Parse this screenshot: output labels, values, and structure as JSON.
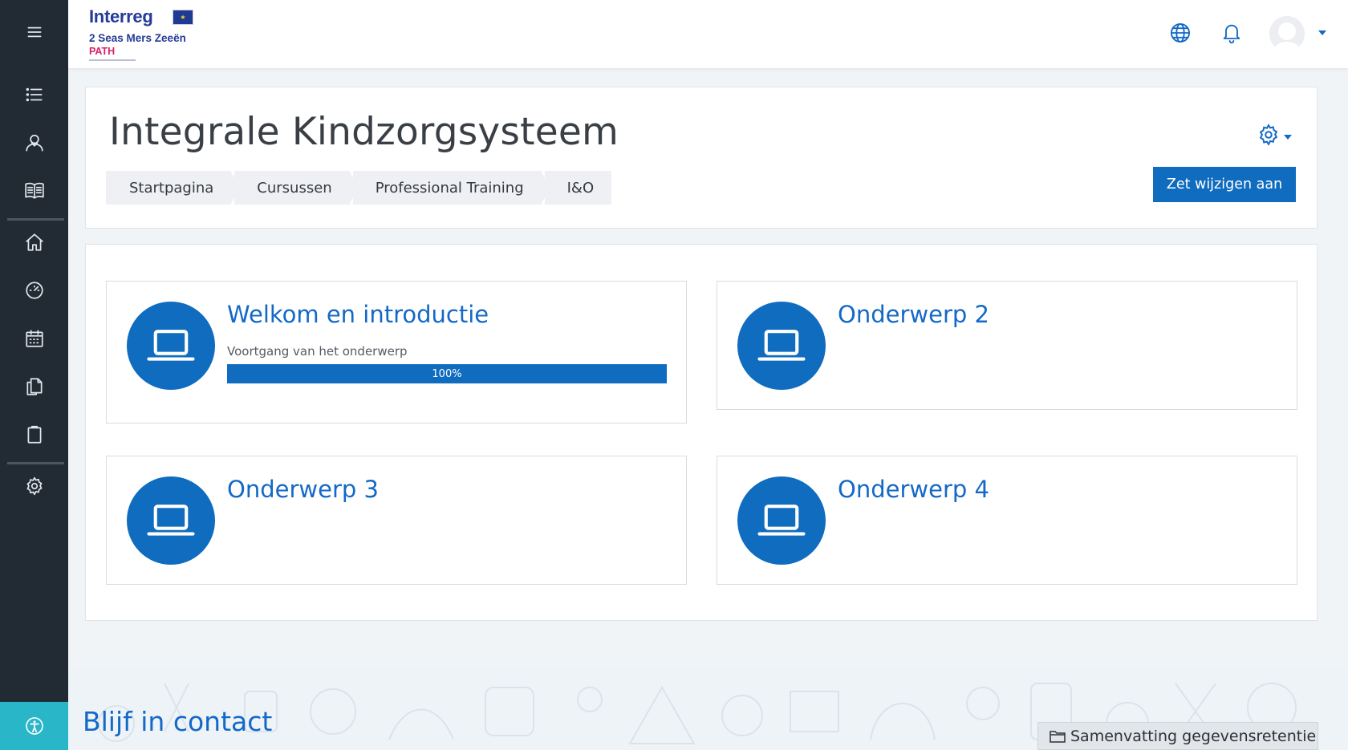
{
  "logo": {
    "line1": "Interreg",
    "line2": "2 Seas Mers Zeeën",
    "line3": "PATH"
  },
  "sidebar": {
    "items": [
      {
        "icon": "menu-icon"
      },
      {
        "icon": "list-icon"
      },
      {
        "icon": "participants-icon"
      },
      {
        "icon": "book-icon"
      },
      {
        "icon": "home-icon"
      },
      {
        "icon": "dashboard-icon"
      },
      {
        "icon": "calendar-icon"
      },
      {
        "icon": "files-icon"
      },
      {
        "icon": "clipboard-icon"
      },
      {
        "icon": "gear-icon"
      },
      {
        "icon": "accessibility-icon"
      }
    ]
  },
  "topbar": {
    "icons": [
      "globe-icon",
      "bell-icon",
      "avatar",
      "chevron-down-icon"
    ]
  },
  "header": {
    "title": "Integrale Kindzorgsysteem",
    "breadcrumb": [
      "Startpagina",
      "Cursussen",
      "Professional Training",
      "I&O"
    ],
    "edit_button": "Zet wijzigen aan"
  },
  "topics": [
    {
      "title": "Welkom en introductie",
      "progress_label": "Voortgang van het onderwerp",
      "progress_text": "100%",
      "progress": 1.0
    },
    {
      "title": "Onderwerp 2"
    },
    {
      "title": "Onderwerp 3"
    },
    {
      "title": "Onderwerp 4"
    }
  ],
  "footer": {
    "contact_title": "Blijf in contact",
    "retention_button": "Samenvatting gegevensretentie"
  },
  "colors": {
    "sidebar_bg": "#222b33",
    "accent": "#0f6cbf",
    "accessibility_bg": "#29b6c8",
    "page_bg": "#f1f4f7"
  }
}
